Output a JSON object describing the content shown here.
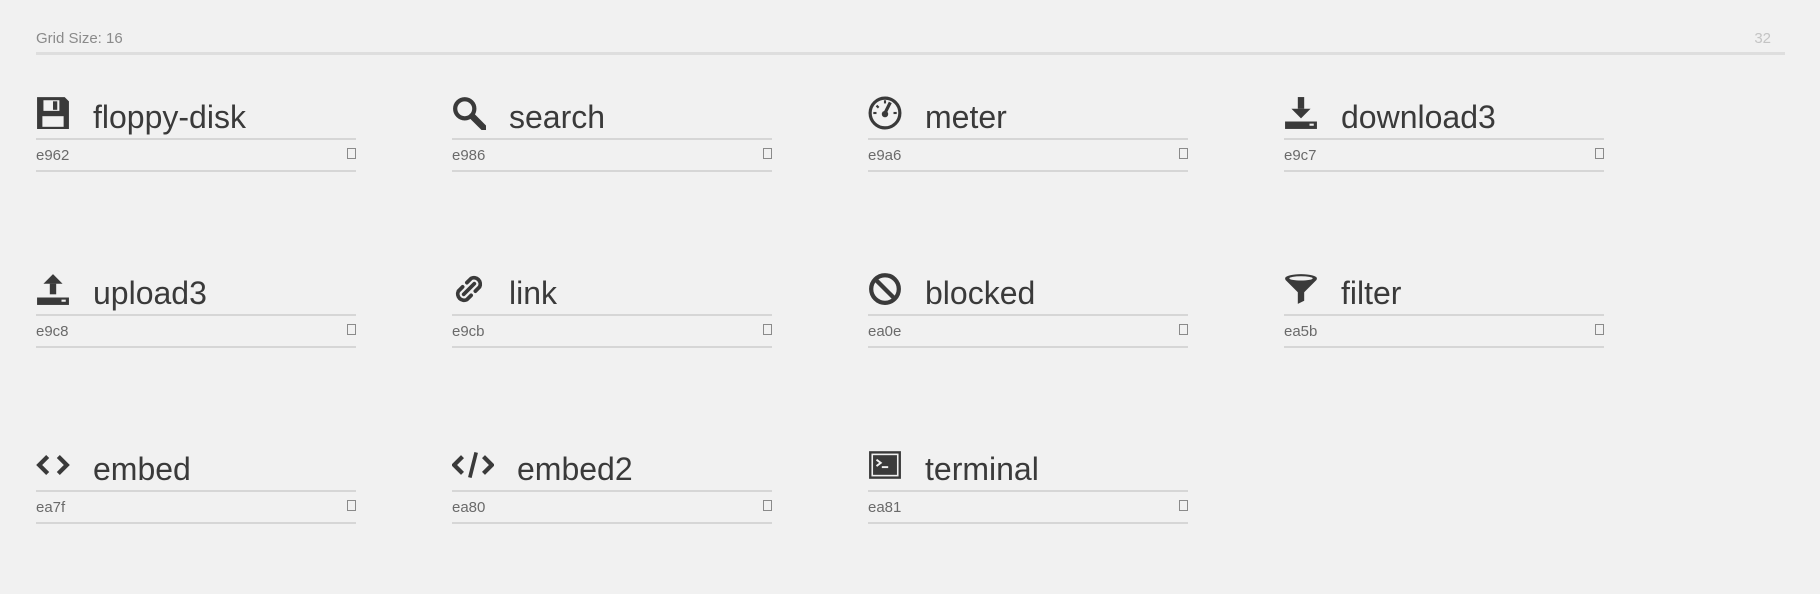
{
  "header": {
    "grid_label": "Grid Size: 16",
    "grid_size_value": "32"
  },
  "glyphs": [
    {
      "name": "floppy-disk",
      "code": "e962",
      "icon": "floppy-disk-icon"
    },
    {
      "name": "search",
      "code": "e986",
      "icon": "search-icon"
    },
    {
      "name": "meter",
      "code": "e9a6",
      "icon": "meter-icon"
    },
    {
      "name": "download3",
      "code": "e9c7",
      "icon": "download3-icon"
    },
    {
      "name": "upload3",
      "code": "e9c8",
      "icon": "upload3-icon"
    },
    {
      "name": "link",
      "code": "e9cb",
      "icon": "link-icon"
    },
    {
      "name": "blocked",
      "code": "ea0e",
      "icon": "blocked-icon"
    },
    {
      "name": "filter",
      "code": "ea5b",
      "icon": "filter-icon"
    },
    {
      "name": "embed",
      "code": "ea7f",
      "icon": "embed-icon"
    },
    {
      "name": "embed2",
      "code": "ea80",
      "icon": "embed2-icon"
    },
    {
      "name": "terminal",
      "code": "ea81",
      "icon": "terminal-icon"
    }
  ],
  "colors": {
    "background": "#f1f1f1",
    "text": "#3a3a3a",
    "divider": "#d6d6d6"
  }
}
